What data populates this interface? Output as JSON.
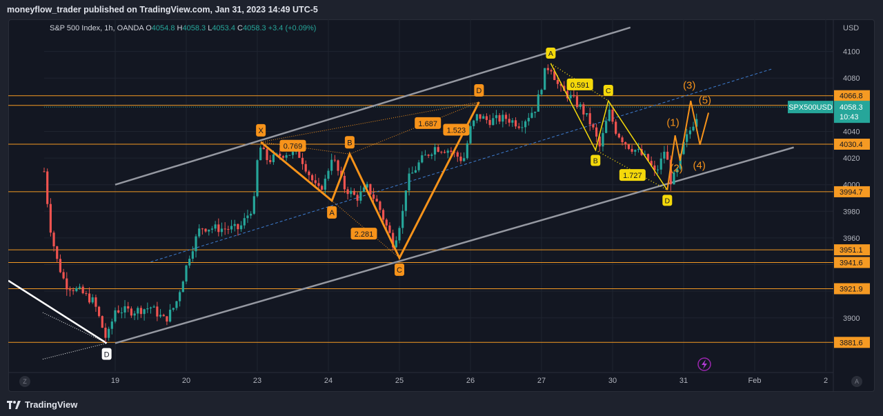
{
  "header": {
    "title": "moneyflow_trader published on TradingView.com, Jan 31, 2023 14:49 UTC-5"
  },
  "legend": {
    "symbol": "S&P 500 Index, 1h, OANDA",
    "o_label": "O",
    "o": "4054.8",
    "h_label": "H",
    "h": "4058.3",
    "l_label": "L",
    "l": "4053.4",
    "c_label": "C",
    "c": "4058.3",
    "change": "+3.4 (+0.09%)"
  },
  "footer": {
    "brand": "TradingView"
  },
  "corner": {
    "left": "Z",
    "right": "A"
  },
  "chart_data": {
    "type": "candlestick",
    "yaxis_unit": "USD",
    "ylim": [
      3860,
      4120
    ],
    "yticks": [
      3900,
      3920,
      3940,
      3960,
      3980,
      4000,
      4020,
      4040,
      4060,
      4080,
      4100
    ],
    "xticks": [
      {
        "x": 0.5,
        "label": "19"
      },
      {
        "x": 1.5,
        "label": "20"
      },
      {
        "x": 2.5,
        "label": "23"
      },
      {
        "x": 3.5,
        "label": "24"
      },
      {
        "x": 4.5,
        "label": "25"
      },
      {
        "x": 5.5,
        "label": "26"
      },
      {
        "x": 6.5,
        "label": "27"
      },
      {
        "x": 7.5,
        "label": "30"
      },
      {
        "x": 8.5,
        "label": "31"
      },
      {
        "x": 9.5,
        "label": "Feb"
      },
      {
        "x": 10.5,
        "label": "2"
      }
    ],
    "close_path": [
      [
        -0.5,
        4010
      ],
      [
        -0.42,
        3970
      ],
      [
        -0.33,
        3945
      ],
      [
        -0.2,
        3925
      ],
      [
        0.0,
        3920
      ],
      [
        0.2,
        3912
      ],
      [
        0.38,
        3883
      ],
      [
        0.5,
        3906
      ],
      [
        0.75,
        3905
      ],
      [
        1.0,
        3908
      ],
      [
        1.2,
        3898
      ],
      [
        1.35,
        3910
      ],
      [
        1.55,
        3948
      ],
      [
        1.7,
        3968
      ],
      [
        2.0,
        3967
      ],
      [
        2.25,
        3967
      ],
      [
        2.45,
        3985
      ],
      [
        2.52,
        4030
      ],
      [
        2.65,
        4018
      ],
      [
        2.9,
        4024
      ],
      [
        3.1,
        4022
      ],
      [
        3.35,
        3995
      ],
      [
        3.45,
        4002
      ],
      [
        3.55,
        4022
      ],
      [
        3.72,
        3998
      ],
      [
        3.9,
        3990
      ],
      [
        4.05,
        3998
      ],
      [
        4.2,
        3985
      ],
      [
        4.42,
        3955
      ],
      [
        4.55,
        3980
      ],
      [
        4.6,
        4002
      ],
      [
        4.8,
        4018
      ],
      [
        5.0,
        4028
      ],
      [
        5.2,
        4026
      ],
      [
        5.4,
        4018
      ],
      [
        5.5,
        4042
      ],
      [
        5.6,
        4052
      ],
      [
        5.75,
        4048
      ],
      [
        6.0,
        4050
      ],
      [
        6.2,
        4045
      ],
      [
        6.42,
        4058
      ],
      [
        6.55,
        4085
      ],
      [
        6.62,
        4090
      ],
      [
        6.75,
        4072
      ],
      [
        6.9,
        4066
      ],
      [
        7.05,
        4058
      ],
      [
        7.2,
        4045
      ],
      [
        7.32,
        4028
      ],
      [
        7.45,
        4055
      ],
      [
        7.55,
        4040
      ],
      [
        7.7,
        4030
      ],
      [
        7.85,
        4025
      ],
      [
        8.0,
        4018
      ],
      [
        8.1,
        4008
      ],
      [
        8.2,
        4020
      ],
      [
        8.25,
        4030
      ],
      [
        8.3,
        4002
      ],
      [
        8.4,
        4008
      ],
      [
        8.5,
        4030
      ],
      [
        8.6,
        4042
      ],
      [
        8.7,
        4054
      ],
      [
        8.72,
        4058.3
      ]
    ],
    "current_price": 4058.3,
    "current_label": "SPX500USD",
    "countdown": "10:43",
    "price_levels": [
      {
        "value": 4066.8,
        "label": "4066.8"
      },
      {
        "value": 4059.5,
        "label": "4059.5"
      },
      {
        "value": 4030.4,
        "label": "4030.4"
      },
      {
        "value": 3994.7,
        "label": "3994.7"
      },
      {
        "value": 3951.1,
        "label": "3951.1"
      },
      {
        "value": 3941.6,
        "label": "3941.6"
      },
      {
        "value": 3921.9,
        "label": "3921.9"
      },
      {
        "value": 3881.6,
        "label": "3881.6"
      }
    ],
    "channel": {
      "upper": [
        [
          0.5,
          4000
        ],
        [
          7.75,
          4118
        ]
      ],
      "lower": [
        [
          0.5,
          3881
        ],
        [
          10.05,
          4028
        ]
      ],
      "mid": [
        [
          1.0,
          3942
        ],
        [
          9.75,
          4087
        ]
      ]
    },
    "pattern_large": {
      "points": [
        {
          "label": "X",
          "x": 2.55,
          "y": 4032
        },
        {
          "label": "A",
          "x": 3.55,
          "y": 3988
        },
        {
          "label": "B",
          "x": 3.8,
          "y": 4023
        },
        {
          "label": "C",
          "x": 4.5,
          "y": 3945
        },
        {
          "label": "D",
          "x": 5.62,
          "y": 4062
        }
      ],
      "ratios": [
        {
          "label": "0.769",
          "x": 3.0,
          "y": 4029
        },
        {
          "label": "1.687",
          "x": 4.9,
          "y": 4046
        },
        {
          "label": "1.523",
          "x": 5.3,
          "y": 4041
        },
        {
          "label": "2.281",
          "x": 4.0,
          "y": 3963
        }
      ]
    },
    "pattern_small": {
      "points": [
        {
          "label": "A",
          "x": 6.63,
          "y": 4091
        },
        {
          "label": "B",
          "x": 7.26,
          "y": 4026
        },
        {
          "label": "C",
          "x": 7.44,
          "y": 4063
        },
        {
          "label": "D",
          "x": 8.27,
          "y": 3996
        }
      ],
      "ratios": [
        {
          "label": "0.591",
          "x": 7.04,
          "y": 4075
        },
        {
          "label": "1.727",
          "x": 7.78,
          "y": 4007
        }
      ]
    },
    "waves": [
      {
        "label": "(1)",
        "x": 8.35,
        "y": 4044
      },
      {
        "label": "(2)",
        "x": 8.4,
        "y": 4010
      },
      {
        "label": "(3)",
        "x": 8.58,
        "y": 4072
      },
      {
        "label": "(4)",
        "x": 8.72,
        "y": 4012
      },
      {
        "label": "(5)",
        "x": 8.8,
        "y": 4061
      }
    ],
    "prior_d": {
      "label": "D",
      "x": 0.38,
      "y": 3881
    }
  }
}
